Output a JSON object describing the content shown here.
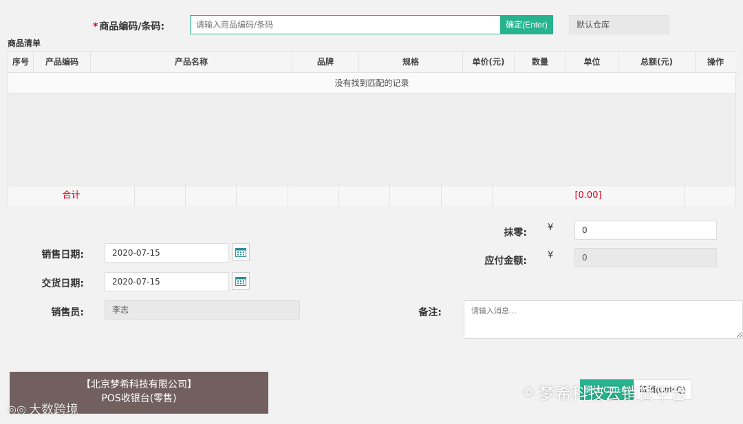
{
  "search": {
    "required_mark": "*",
    "label": "商品编码/条码:",
    "placeholder": "请输入商品编码/条码",
    "confirm_label": "确定(Enter)",
    "warehouse": "默认仓库"
  },
  "list": {
    "title": "商品清单",
    "columns": [
      "序号",
      "产品编码",
      "产品名称",
      "品牌",
      "规格",
      "单价(元)",
      "数量",
      "单位",
      "总额(元)",
      "操作"
    ],
    "empty_text": "没有找到匹配的记录",
    "total_label": "合计",
    "total_value": "[0.00]"
  },
  "form": {
    "sale_date_label": "销售日期:",
    "sale_date_value": "2020-07-15",
    "delivery_date_label": "交货日期:",
    "delivery_date_value": "2020-07-15",
    "salesperson_label": "销售员:",
    "salesperson_value": "李志",
    "rounding_label": "抹零:",
    "rounding_value": "0",
    "payable_label": "应付金额:",
    "payable_value": "0",
    "currency_symbol": "¥",
    "note_label": "备注:",
    "note_placeholder": "请输入消息..."
  },
  "footer": {
    "company_line1": "【北京梦希科技有限公司】",
    "company_line2": "POS收银台(零售)",
    "submit_label": "确认(Ctrl+S)",
    "cancel_label": "取消(Ctrl+Q)",
    "watermark_left": "大数跨境",
    "watermark_right": "梦希科技云销货平台"
  },
  "colors": {
    "accent": "#27b38d",
    "required": "#d9001b",
    "company_bg": "#726060"
  }
}
